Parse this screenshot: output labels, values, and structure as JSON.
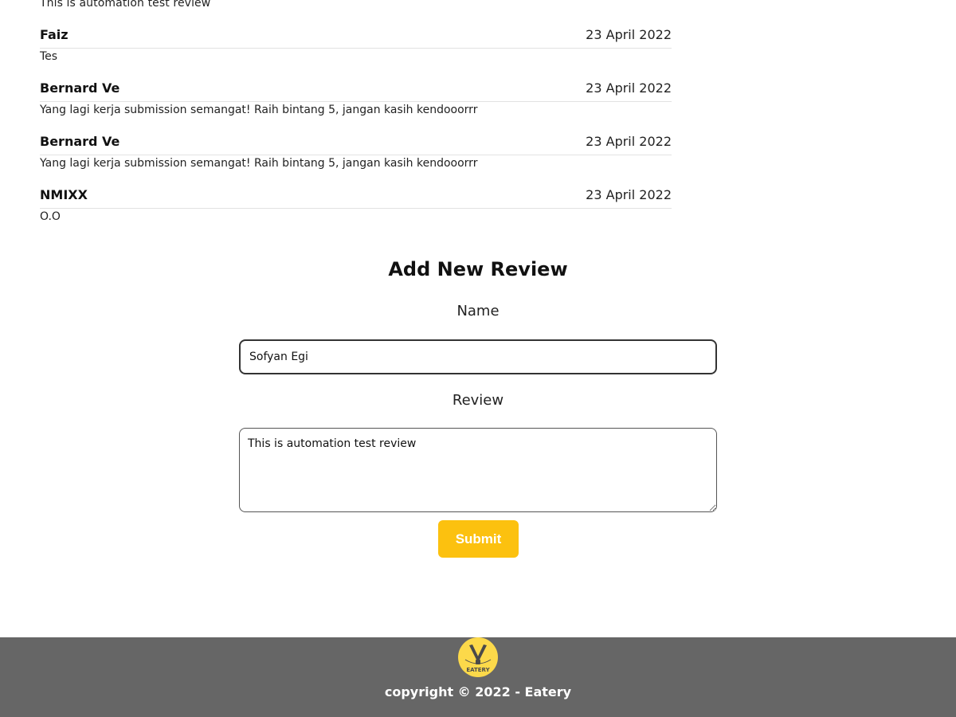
{
  "reviews": {
    "partial_top_text": "This is automation test review",
    "items": [
      {
        "name": "Faiz",
        "date": "23 April 2022",
        "text": "Tes"
      },
      {
        "name": "Bernard Ve",
        "date": "23 April 2022",
        "text": "Yang lagi kerja submission semangat! Raih bintang 5, jangan kasih kendooorrr"
      },
      {
        "name": "Bernard Ve",
        "date": "23 April 2022",
        "text": "Yang lagi kerja submission semangat! Raih bintang 5, jangan kasih kendooorrr"
      },
      {
        "name": "NMIXX",
        "date": "23 April 2022",
        "text": "O.O"
      }
    ]
  },
  "form": {
    "title": "Add New Review",
    "name_label": "Name",
    "name_value": "Sofyan Egi",
    "review_label": "Review",
    "review_value": "This is automation test review",
    "submit_label": "Submit"
  },
  "footer": {
    "logo_text": "EATERY",
    "copyright": "copyright © 2022 - Eatery",
    "logo_color": "#fcd94a",
    "background_color": "#666666"
  }
}
